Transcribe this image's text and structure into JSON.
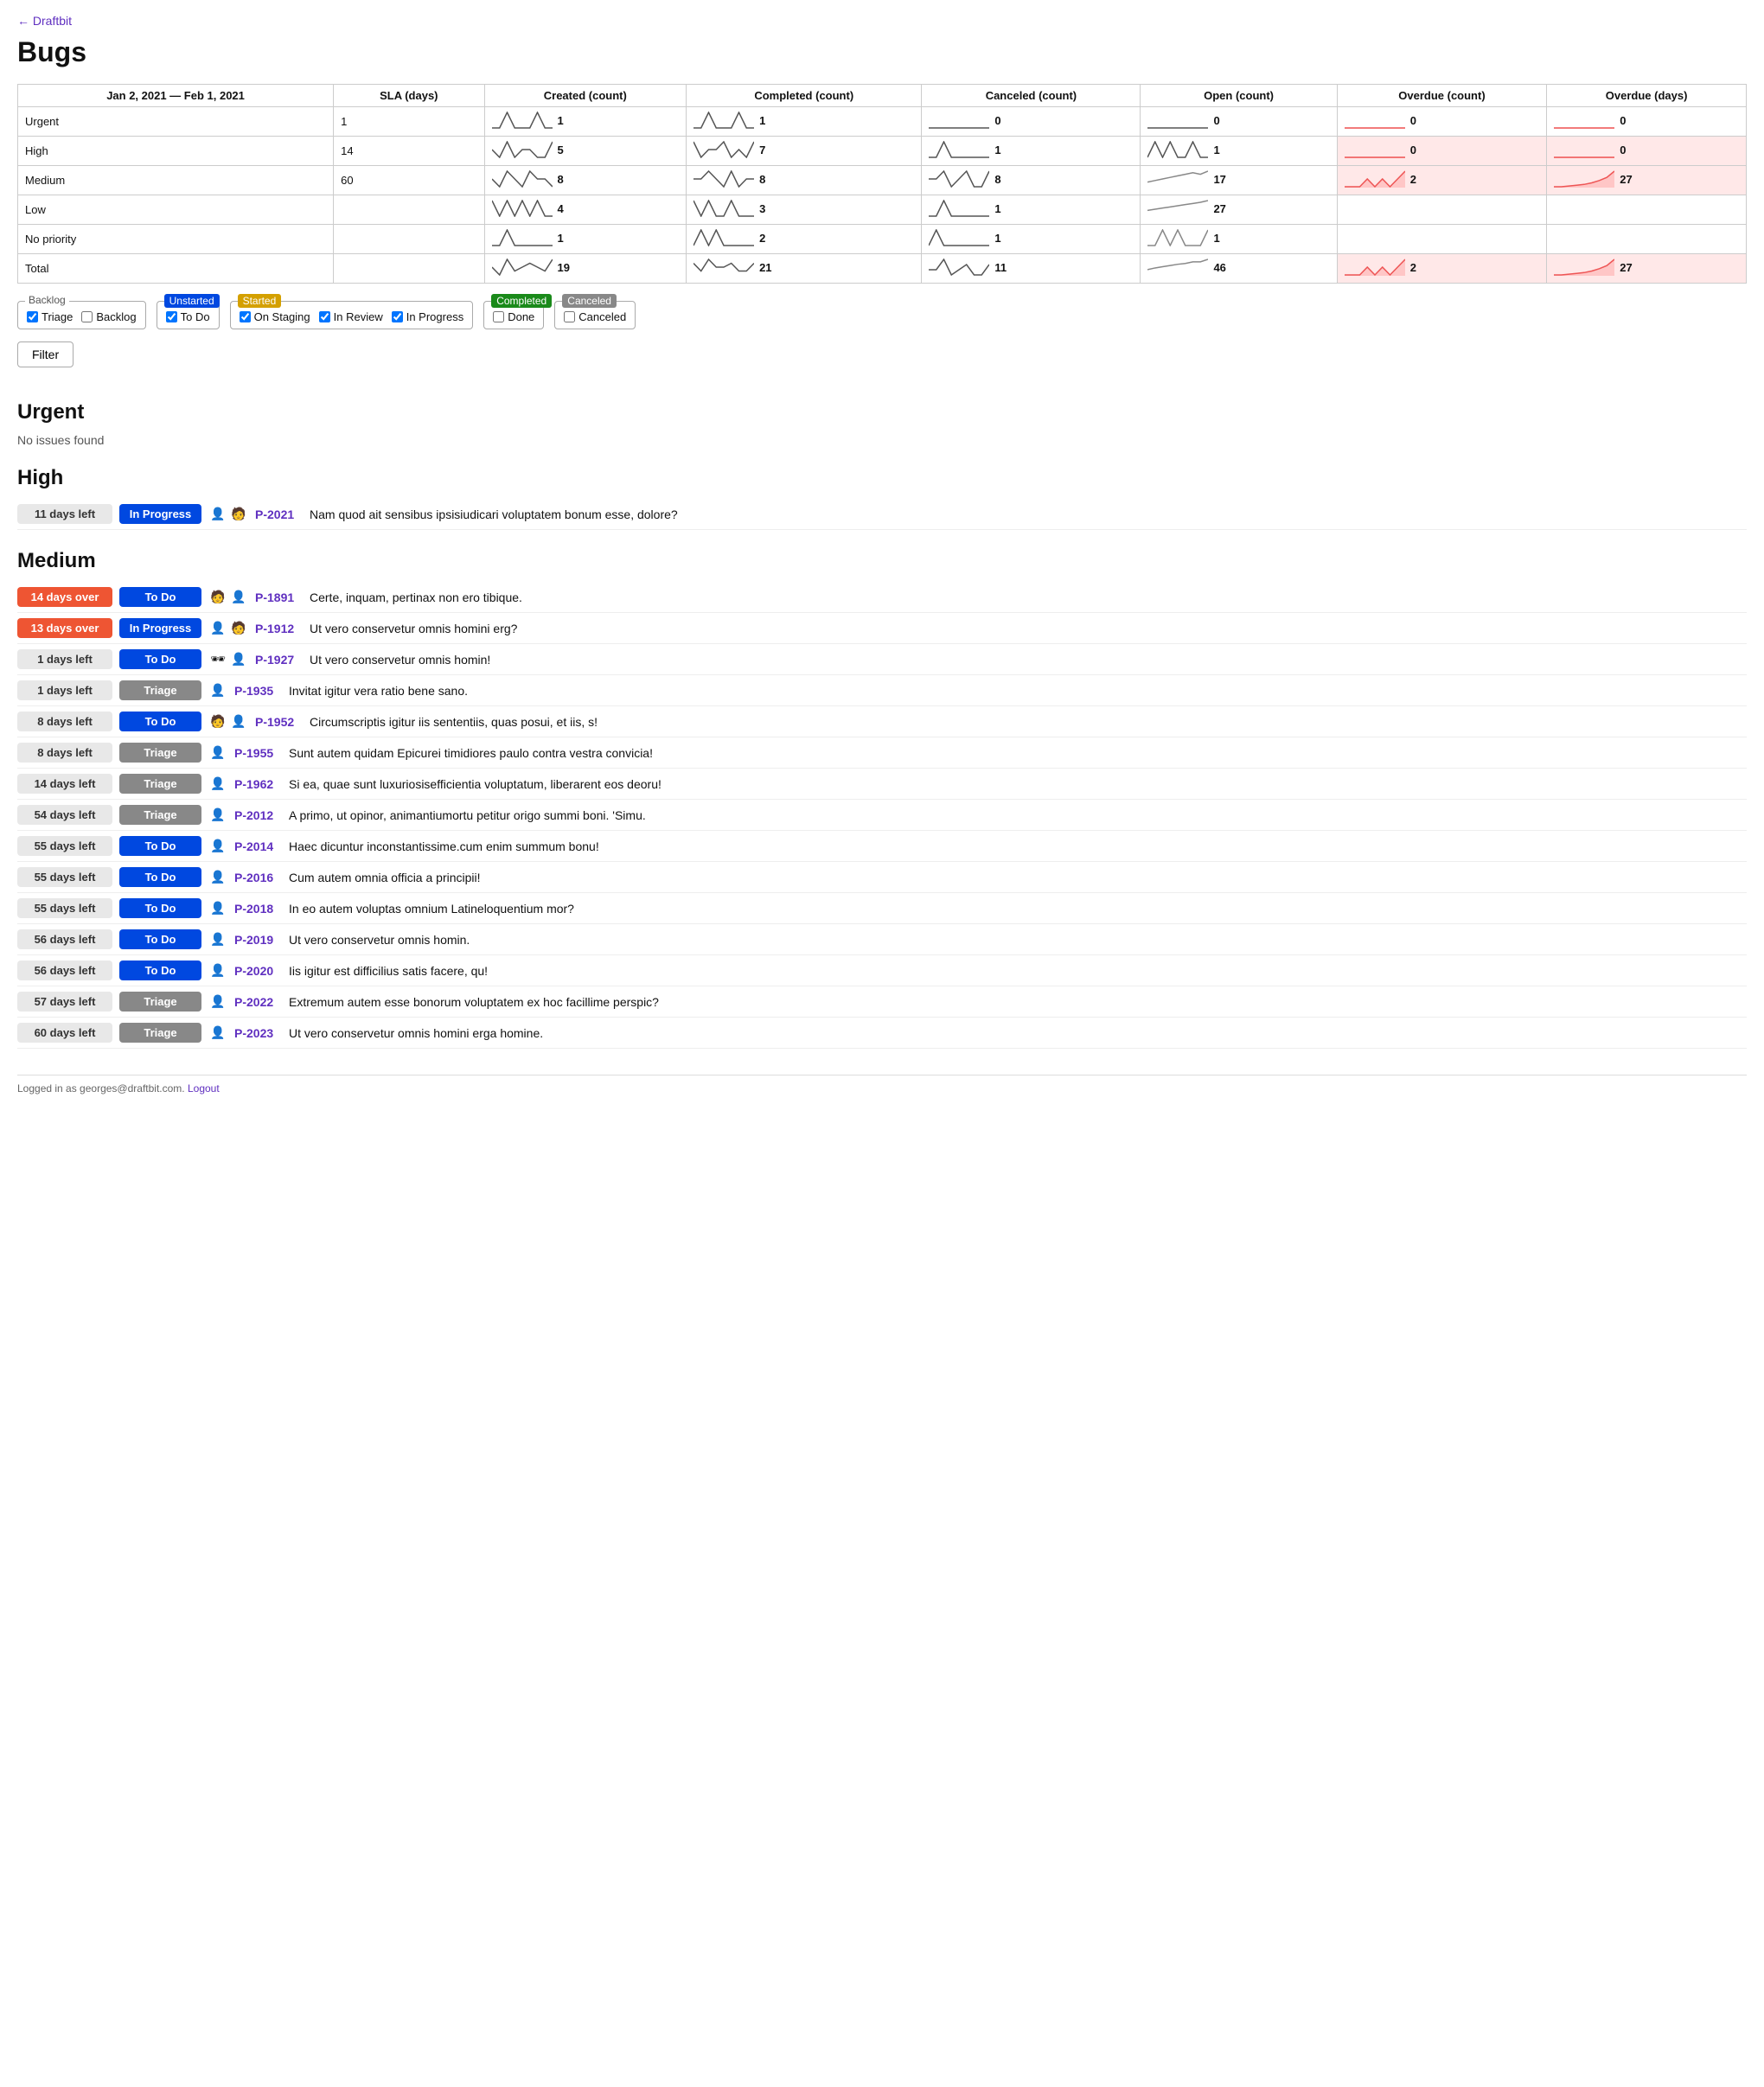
{
  "nav": {
    "back_label": "← Draftbit"
  },
  "page": {
    "title": "Bugs",
    "date_range": "Jan 2, 2021 — Feb 1, 2021"
  },
  "table": {
    "headers": [
      "Jan 2, 2021 — Feb 1, 2021",
      "SLA (days)",
      "Created (count)",
      "Completed (count)",
      "Canceled (count)",
      "Open (count)",
      "Overdue (count)",
      "Overdue (days)"
    ],
    "rows": [
      {
        "label": "Urgent",
        "sla": "1",
        "created": 1,
        "completed": 1,
        "canceled": 0,
        "open": 0,
        "overdue_count": 0,
        "overdue_days": 0,
        "overdue_class": ""
      },
      {
        "label": "High",
        "sla": "14",
        "created": 5,
        "completed": 7,
        "canceled": 1,
        "open": 1,
        "overdue_count": 0,
        "overdue_days": 0,
        "overdue_class": "overdue-pink"
      },
      {
        "label": "Medium",
        "sla": "60",
        "created": 8,
        "completed": 8,
        "canceled": 8,
        "open": 17,
        "overdue_count": 2,
        "overdue_days": 27,
        "overdue_class": "overdue-pink"
      },
      {
        "label": "Low",
        "sla": "",
        "created": 4,
        "completed": 3,
        "canceled": 1,
        "open": 27,
        "overdue_count": "",
        "overdue_days": "",
        "overdue_class": ""
      },
      {
        "label": "No priority",
        "sla": "",
        "created": 1,
        "completed": 2,
        "canceled": 1,
        "open": 1,
        "overdue_count": "",
        "overdue_days": "",
        "overdue_class": ""
      },
      {
        "label": "Total",
        "sla": "",
        "created": 19,
        "completed": 21,
        "canceled": 11,
        "open": 46,
        "overdue_count": 2,
        "overdue_days": 27,
        "overdue_class": "overdue-pink"
      }
    ]
  },
  "filters": {
    "backlog": {
      "label": "Backlog",
      "items": [
        {
          "label": "Triage",
          "checked": true
        },
        {
          "label": "Backlog",
          "checked": false
        }
      ]
    },
    "unstarted": {
      "label": "Unstarted",
      "items": [
        {
          "label": "To Do",
          "checked": true
        }
      ]
    },
    "started": {
      "label": "Started",
      "items": [
        {
          "label": "On Staging",
          "checked": true
        },
        {
          "label": "In Review",
          "checked": true
        },
        {
          "label": "In Progress",
          "checked": true
        }
      ]
    },
    "completed": {
      "label": "Completed",
      "items": [
        {
          "label": "Done",
          "checked": false
        }
      ]
    },
    "canceled": {
      "label": "Canceled",
      "items": [
        {
          "label": "Canceled",
          "checked": false
        }
      ]
    }
  },
  "filter_button": "Filter",
  "sections": [
    {
      "title": "Urgent",
      "no_issues": "No issues found",
      "issues": []
    },
    {
      "title": "High",
      "no_issues": null,
      "issues": [
        {
          "days_label": "11 days left",
          "days_type": "left",
          "status": "In Progress",
          "status_type": "inprogress",
          "avatars": [
            "👤",
            "🧑"
          ],
          "id": "P-2021",
          "text": "Nam quod ait sensibus ipsisiudicari voluptatem bonum esse, dolore?"
        }
      ]
    },
    {
      "title": "Medium",
      "no_issues": null,
      "issues": [
        {
          "days_label": "14 days over",
          "days_type": "over",
          "status": "To Do",
          "status_type": "todo",
          "avatars": [
            "🧑",
            "👤"
          ],
          "id": "P-1891",
          "text": "Certe, inquam, pertinax non ero tibique."
        },
        {
          "days_label": "13 days over",
          "days_type": "over",
          "status": "In Progress",
          "status_type": "inprogress",
          "avatars": [
            "👤",
            "🧑"
          ],
          "id": "P-1912",
          "text": "Ut vero conservetur omnis homini erg?"
        },
        {
          "days_label": "1 days left",
          "days_type": "left",
          "status": "To Do",
          "status_type": "todo",
          "avatars": [
            "🕶",
            "👤"
          ],
          "id": "P-1927",
          "text": "Ut vero conservetur omnis homin!"
        },
        {
          "days_label": "1 days left",
          "days_type": "left",
          "status": "Triage",
          "status_type": "triage",
          "avatars": [
            "👤"
          ],
          "id": "P-1935",
          "text": "Invitat igitur vera ratio bene sano."
        },
        {
          "days_label": "8 days left",
          "days_type": "left",
          "status": "To Do",
          "status_type": "todo",
          "avatars": [
            "🧑",
            "👤"
          ],
          "id": "P-1952",
          "text": "Circumscriptis igitur iis sententiis, quas posui, et iis, s!"
        },
        {
          "days_label": "8 days left",
          "days_type": "left",
          "status": "Triage",
          "status_type": "triage",
          "avatars": [
            "👤"
          ],
          "id": "P-1955",
          "text": "Sunt autem quidam Epicurei timidiores paulo contra vestra convicia!"
        },
        {
          "days_label": "14 days left",
          "days_type": "left",
          "status": "Triage",
          "status_type": "triage",
          "avatars": [
            "👤"
          ],
          "id": "P-1962",
          "text": "Si ea, quae sunt luxuriosisefficientia voluptatum, liberarent eos deoru!"
        },
        {
          "days_label": "54 days left",
          "days_type": "left",
          "status": "Triage",
          "status_type": "triage",
          "avatars": [
            "👤"
          ],
          "id": "P-2012",
          "text": "A primo, ut opinor, animantiumortu petitur origo summi boni. 'Simu."
        },
        {
          "days_label": "55 days left",
          "days_type": "left",
          "status": "To Do",
          "status_type": "todo",
          "avatars": [
            "👤"
          ],
          "id": "P-2014",
          "text": "Haec dicuntur inconstantissime.cum enim summum bonu!"
        },
        {
          "days_label": "55 days left",
          "days_type": "left",
          "status": "To Do",
          "status_type": "todo",
          "avatars": [
            "👤"
          ],
          "id": "P-2016",
          "text": "Cum autem omnia officia a principii!"
        },
        {
          "days_label": "55 days left",
          "days_type": "left",
          "status": "To Do",
          "status_type": "todo",
          "avatars": [
            "👤"
          ],
          "id": "P-2018",
          "text": "In eo autem voluptas omnium Latineloquentium mor?"
        },
        {
          "days_label": "56 days left",
          "days_type": "left",
          "status": "To Do",
          "status_type": "todo",
          "avatars": [
            "👤"
          ],
          "id": "P-2019",
          "text": "Ut vero conservetur omnis homin."
        },
        {
          "days_label": "56 days left",
          "days_type": "left",
          "status": "To Do",
          "status_type": "todo",
          "avatars": [
            "👤"
          ],
          "id": "P-2020",
          "text": "Iis igitur est difficilius satis facere, qu!"
        },
        {
          "days_label": "57 days left",
          "days_type": "left",
          "status": "Triage",
          "status_type": "triage",
          "avatars": [
            "👤"
          ],
          "id": "P-2022",
          "text": "Extremum autem esse bonorum voluptatem ex hoc facillime perspic?"
        },
        {
          "days_label": "60 days left",
          "days_type": "left",
          "status": "Triage",
          "status_type": "triage",
          "avatars": [
            "👤"
          ],
          "id": "P-2023",
          "text": "Ut vero conservetur omnis homini erga homine."
        }
      ]
    }
  ],
  "footer": {
    "text": "Logged in as georges@draftbit.com.",
    "logout_label": "Logout"
  }
}
